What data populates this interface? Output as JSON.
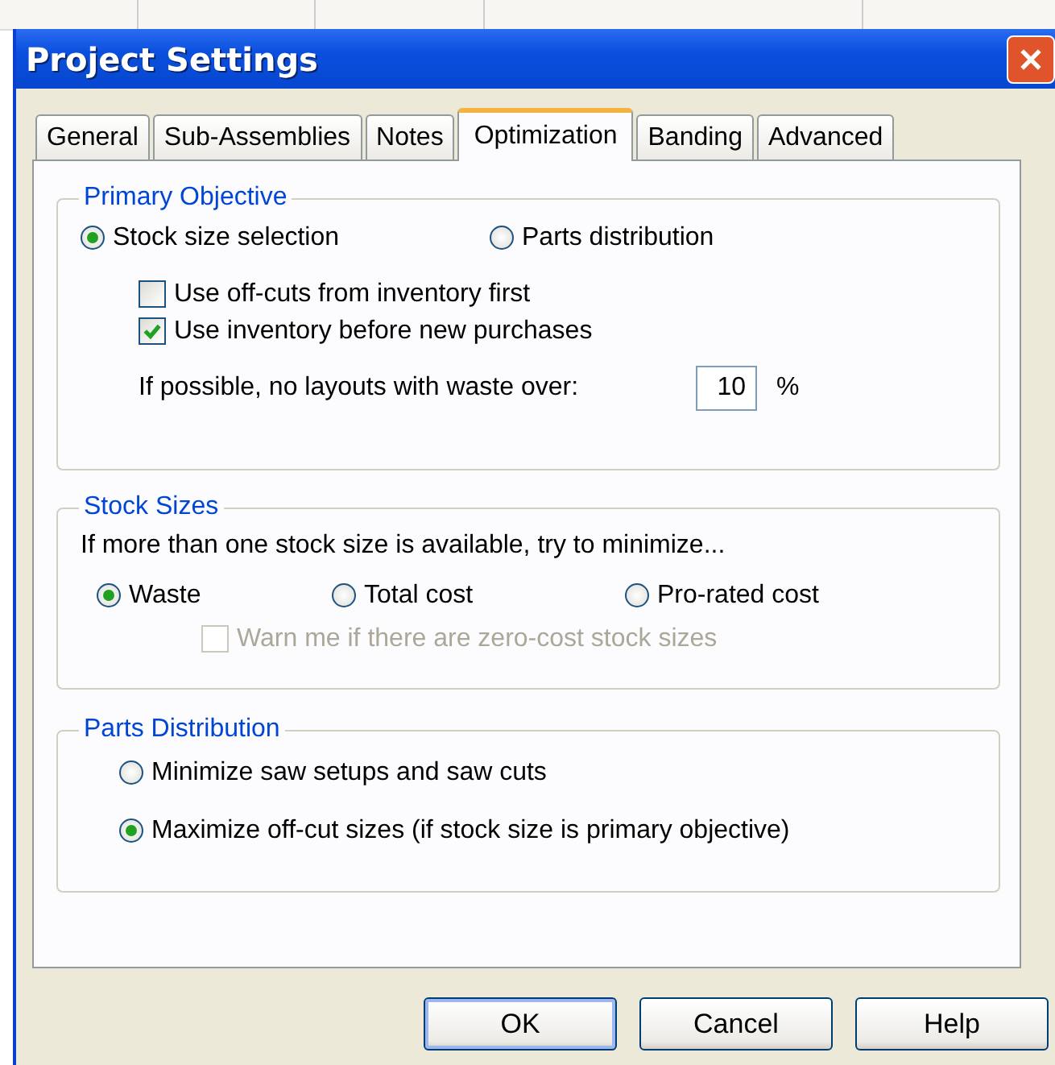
{
  "window": {
    "title": "Project Settings"
  },
  "tabs": [
    {
      "label": "General",
      "selected": false
    },
    {
      "label": "Sub-Assemblies",
      "selected": false
    },
    {
      "label": "Notes",
      "selected": false
    },
    {
      "label": "Optimization",
      "selected": true
    },
    {
      "label": "Banding",
      "selected": false
    },
    {
      "label": "Advanced",
      "selected": false
    }
  ],
  "primary_objective": {
    "legend": "Primary Objective",
    "options": [
      {
        "label": "Stock size selection",
        "selected": true
      },
      {
        "label": "Parts distribution",
        "selected": false
      }
    ],
    "checkboxes": [
      {
        "label": "Use off-cuts from inventory first",
        "checked": false,
        "disabled": false
      },
      {
        "label": "Use inventory before new purchases",
        "checked": true,
        "disabled": false
      }
    ],
    "waste_limit": {
      "label": "If possible, no layouts with waste over:",
      "value": "10",
      "unit": "%"
    }
  },
  "stock_sizes": {
    "legend": "Stock Sizes",
    "prompt": "If more than one stock size is available, try to minimize...",
    "options": [
      {
        "label": "Waste",
        "selected": true
      },
      {
        "label": "Total cost",
        "selected": false
      },
      {
        "label": "Pro-rated cost",
        "selected": false
      }
    ],
    "checkboxes": [
      {
        "label": "Warn me if there are zero-cost stock sizes",
        "checked": false,
        "disabled": true
      }
    ]
  },
  "parts_distribution": {
    "legend": "Parts Distribution",
    "options": [
      {
        "label": "Minimize saw setups and saw cuts",
        "selected": false
      },
      {
        "label": "Maximize off-cut sizes (if stock size is primary objective)",
        "selected": true
      }
    ]
  },
  "buttons": [
    {
      "label": "OK",
      "default": true
    },
    {
      "label": "Cancel",
      "default": false
    },
    {
      "label": "Help",
      "default": false
    }
  ]
}
